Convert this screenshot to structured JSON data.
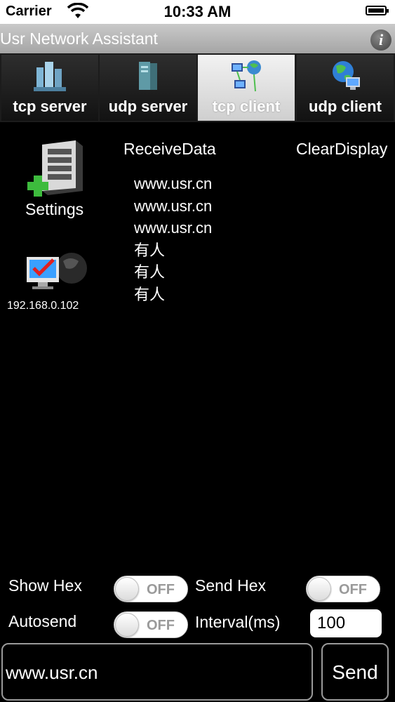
{
  "status_bar": {
    "carrier": "Carrier",
    "time": "10:33 AM",
    "wifi_icon": "wifi-icon",
    "battery_icon": "battery-icon"
  },
  "app": {
    "title": "Usr Network Assistant",
    "info_icon": "info-icon",
    "info_glyph": "i"
  },
  "tabs": [
    {
      "label": "tcp server",
      "icon": "server-buildings-icon",
      "active": false
    },
    {
      "label": "udp server",
      "icon": "server-tower-icon",
      "active": false
    },
    {
      "label": "tcp client",
      "icon": "network-computers-icon",
      "active": true
    },
    {
      "label": "udp client",
      "icon": "globe-computer-icon",
      "active": false
    }
  ],
  "sidebar": {
    "settings_label": "Settings",
    "ip_address": "192.168.0.102"
  },
  "receive": {
    "title": "ReceiveData",
    "clear_label": "ClearDisplay",
    "lines": [
      "www.usr.cn",
      "www.usr.cn",
      "www.usr.cn",
      "有人",
      "有人",
      "有人"
    ]
  },
  "controls": {
    "show_hex_label": "Show Hex",
    "show_hex_state": "OFF",
    "send_hex_label": "Send Hex",
    "send_hex_state": "OFF",
    "autosend_label": "Autosend",
    "autosend_state": "OFF",
    "interval_label": "Interval(ms)",
    "interval_value": "100"
  },
  "send": {
    "input_value": "www.usr.cn",
    "button_label": "Send"
  },
  "colors": {
    "background": "#000000",
    "title_bar": "#b5b5b5",
    "active_tab": "#e6e6e6",
    "toggle_text": "#9a9a9a"
  }
}
